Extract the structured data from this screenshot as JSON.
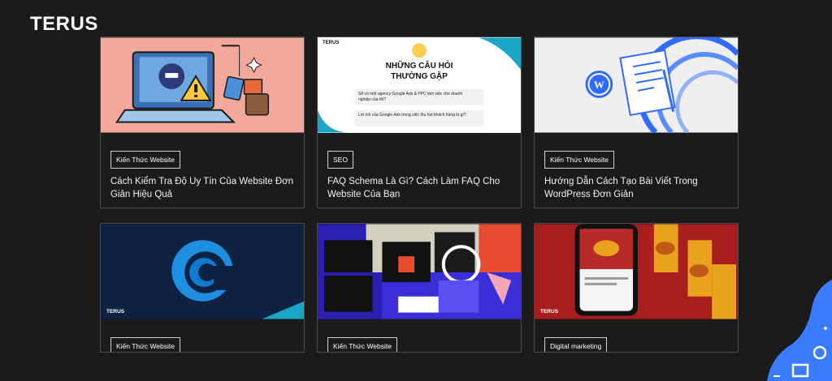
{
  "brand": {
    "logo_text": "TERUS"
  },
  "cards": [
    {
      "tag": "Kiến Thức Website",
      "title": "Cách Kiểm Tra Độ Uy Tín Của Website Đơn Giản Hiệu Quả",
      "thumb_icon": "hacker-laptop-illustration"
    },
    {
      "tag": "SEO",
      "title": "FAQ Schema Là Gì? Cách Làm FAQ Cho Website Của Bạn",
      "thumb_icon": "faq-illustration",
      "thumb": {
        "logo": "TERUS",
        "heading_line1": "NHỮNG CÂU HỎI",
        "heading_line2": "THƯỜNG GẶP",
        "q1": "Sẽ có một agency Google Ads & PPC làm việc cho doanh nghiệp của tôi?",
        "q2": "Lợi ích của Google Ads trong việc thu hút khách hàng là gì?"
      }
    },
    {
      "tag": "Kiến Thức Website",
      "title": "Hướng Dẫn Cách Tạo Bài Viết Trong WordPress Đơn Giản",
      "thumb_icon": "wordpress-notebook-illustration"
    },
    {
      "tag": "Kiến Thức Website",
      "title": "",
      "thumb_icon": "blue-ring-logo",
      "thumb": {
        "logo": "TERUS"
      }
    },
    {
      "tag": "Kiến Thức Website",
      "title": "",
      "thumb_icon": "design-collage"
    },
    {
      "tag": "Digital marketing",
      "title": "",
      "thumb_icon": "food-ads-phone",
      "thumb": {
        "logo": "TERUS"
      }
    }
  ],
  "colors": {
    "background": "#1b1b1b",
    "border": "#4a4a4a",
    "accent_blue": "#2f6bff"
  }
}
